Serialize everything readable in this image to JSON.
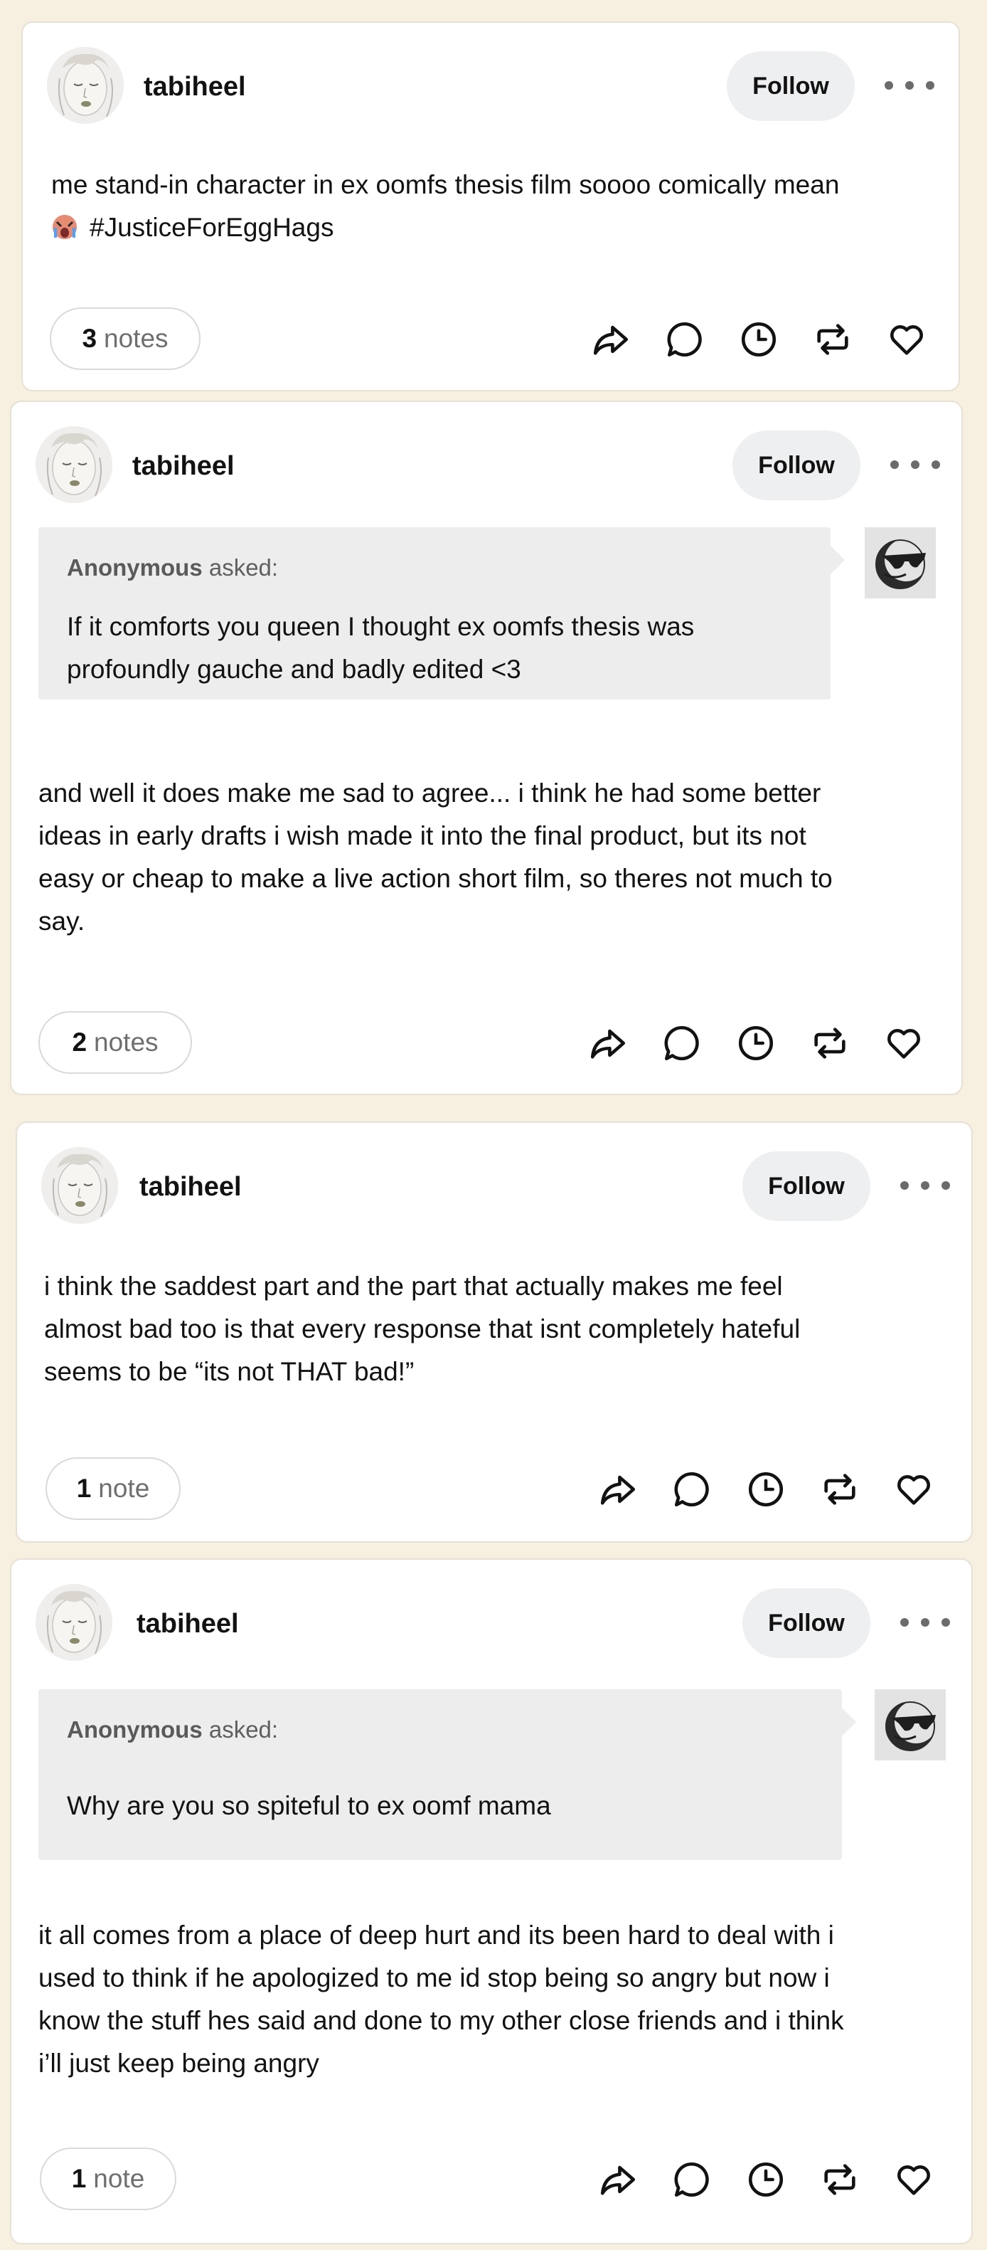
{
  "posts": [
    {
      "blog_name": "tabiheel",
      "follow_label": "Follow",
      "ask": null,
      "body": [
        "me stand-in character in ex oomfs thesis film soooo comically mean",
        "#JusticeForEggHags"
      ],
      "emoji": "crying-face-emoji",
      "notes_count": "3",
      "notes_label": "notes"
    },
    {
      "blog_name": "tabiheel",
      "follow_label": "Follow",
      "ask": {
        "asker": "Anonymous",
        "asked_label": "asked:",
        "question": [
          "If it comforts you queen I thought ex oomfs thesis was",
          "profoundly gauche and badly edited <3"
        ]
      },
      "body": [
        "and well it does make me sad to agree... i think he had some better",
        "ideas in early drafts i wish made it into the final product, but its not",
        "easy or cheap to make a live action short film, so theres not much to",
        "say."
      ],
      "notes_count": "2",
      "notes_label": "notes"
    },
    {
      "blog_name": "tabiheel",
      "follow_label": "Follow",
      "ask": null,
      "body": [
        "i think the saddest part and the part that actually makes me feel",
        "almost bad too is that every response that isnt completely hateful",
        "seems to be “its not THAT bad!”"
      ],
      "notes_count": "1",
      "notes_label": "note"
    },
    {
      "blog_name": "tabiheel",
      "follow_label": "Follow",
      "ask": {
        "asker": "Anonymous",
        "asked_label": "asked:",
        "question": [
          "Why are you so spiteful to ex oomf mama"
        ]
      },
      "body": [
        "it all comes from a place of deep hurt and its been hard to deal with i",
        "used to think if he apologized to me id stop being so angry but now i",
        "know the stuff hes said and done to my other close friends and i think",
        "i’ll just keep being angry"
      ],
      "notes_count": "1",
      "notes_label": "note"
    }
  ],
  "action_icons": [
    "share-icon",
    "reply-icon",
    "queue-clock-icon",
    "reblog-icon",
    "like-heart-icon"
  ],
  "colors": {
    "page_background": "#f7efe0",
    "card": "#ffffff",
    "ask_background": "#ededed",
    "follow_button": "#eeeff1",
    "text": "#121212"
  }
}
